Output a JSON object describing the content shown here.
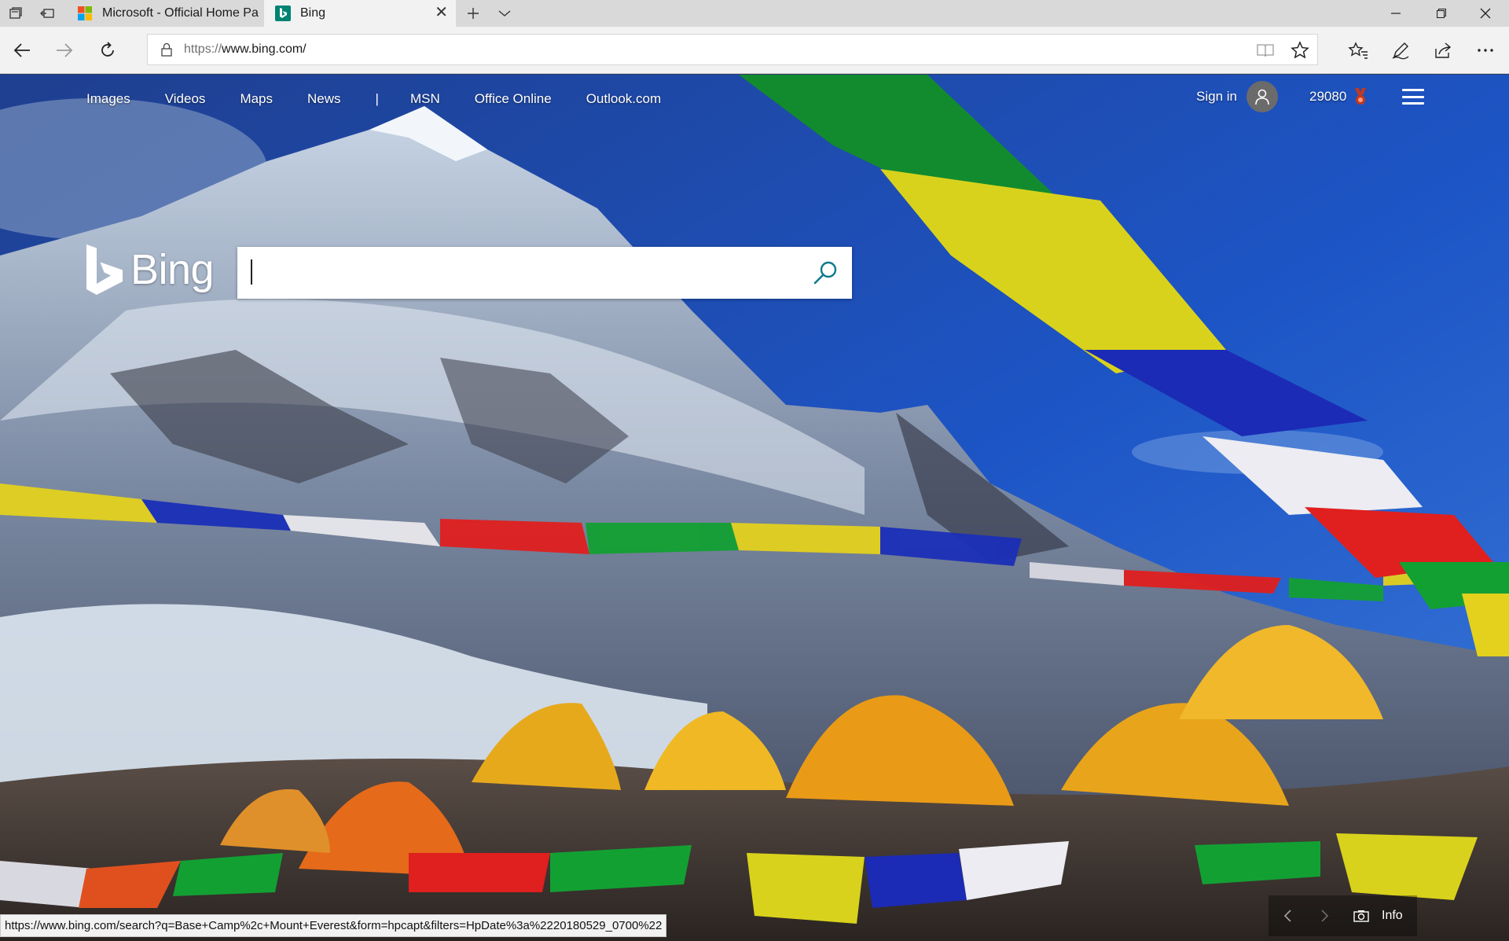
{
  "browser": {
    "tabs": [
      {
        "title": "Microsoft - Official Home Pa",
        "active": false
      },
      {
        "title": "Bing",
        "active": true
      }
    ],
    "address": {
      "protocol": "https://",
      "host": "www.bing.com/"
    },
    "status_url": "https://www.bing.com/search?q=Base+Camp%2c+Mount+Everest&form=hpcapt&filters=HpDate%3a%2220180529_0700%22"
  },
  "bing": {
    "nav": {
      "images": "Images",
      "videos": "Videos",
      "maps": "Maps",
      "news": "News",
      "separator": "|",
      "msn": "MSN",
      "office": "Office Online",
      "outlook": "Outlook.com"
    },
    "signin": "Sign in",
    "rewards_points": "29080",
    "logo_text": "Bing",
    "search": {
      "value": "",
      "placeholder": ""
    },
    "info_label": "Info"
  },
  "colors": {
    "bing_teal": "#008373",
    "reward_red": "#c5381c",
    "chrome_bg": "#f2f2f2"
  }
}
